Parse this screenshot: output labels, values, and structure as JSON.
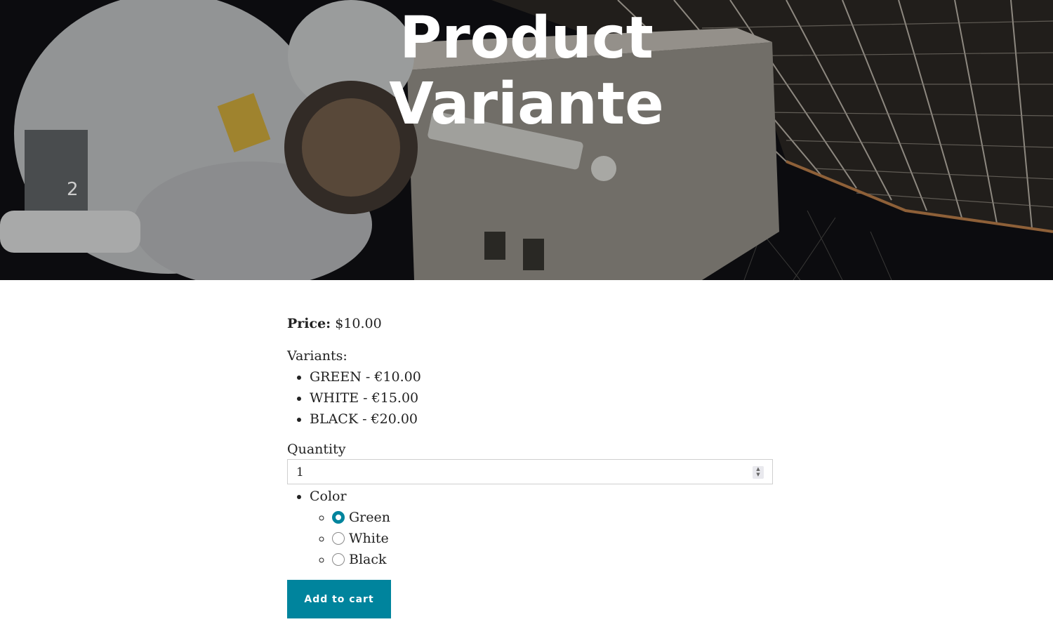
{
  "hero": {
    "title_line1": "Product",
    "title_line2": "Variante"
  },
  "product": {
    "price_label": "Price:",
    "price_value": "$10.00",
    "variants_label": "Variants:",
    "variants": [
      "GREEN - €10.00",
      "WHITE - €15.00",
      "BLACK - €20.00"
    ],
    "quantity_label": "Quantity",
    "quantity_value": "1",
    "option_label": "Color",
    "colors": [
      {
        "label": "Green",
        "checked": true
      },
      {
        "label": "White",
        "checked": false
      },
      {
        "label": "Black",
        "checked": false
      }
    ],
    "add_to_cart_label": "Add to cart"
  },
  "theme": {
    "accent": "#00849d",
    "text": "#222222",
    "hero_text": "#ffffff"
  }
}
